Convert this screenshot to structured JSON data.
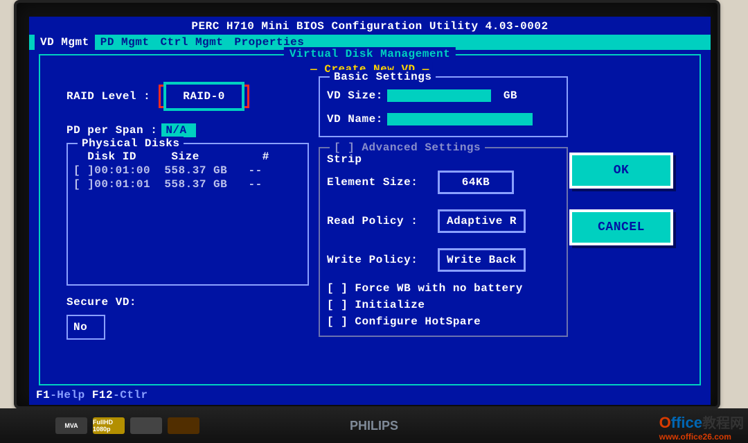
{
  "title": "PERC H710 Mini BIOS Configuration Utility 4.03-0002",
  "menu": {
    "items": [
      "VD Mgmt",
      "PD Mgmt",
      "Ctrl Mgmt",
      "Properties"
    ],
    "active_index": 0
  },
  "outer_frame_title": "Virtual Disk Management",
  "create_title": "— Create New VD —",
  "left": {
    "raid_label": "RAID Level :",
    "raid_value": "RAID-0",
    "pd_span_label": "PD per Span :",
    "pd_span_value": "N/A",
    "phys_group": "Physical Disks",
    "phys_header": "  Disk ID     Size         #",
    "phys_rows": [
      "[ ]00:01:00  558.37 GB   --",
      "[ ]00:01:01  558.37 GB   --"
    ],
    "secure_label": "Secure VD:",
    "secure_value": "No"
  },
  "basic": {
    "group": "Basic Settings",
    "size_label": "VD Size:",
    "size_value": "",
    "size_unit": "GB",
    "name_label": "VD Name:",
    "name_value": ""
  },
  "advanced": {
    "group_prefix": "[ ] Advanced Settings",
    "strip_label1": "Strip",
    "strip_label2": "Element Size:",
    "strip_value": "64KB",
    "read_label": "Read Policy :",
    "read_value": "Adaptive R",
    "write_label": "Write Policy:",
    "write_value": "Write Back",
    "checks": [
      "[ ] Force WB with no battery",
      "[ ] Initialize",
      "[ ] Configure HotSpare"
    ]
  },
  "buttons": {
    "ok": "OK",
    "cancel": "CANCEL"
  },
  "status": {
    "f1": "F1",
    "f1txt": "-Help ",
    "f12": "F12",
    "f12txt": "-Ctlr"
  },
  "monitor_brand": "PHILIPS",
  "bezel_logos": [
    "MVA",
    "FullHD 1080p",
    "",
    ""
  ],
  "watermark": {
    "line1a": "Office",
    "line1b": "教程网",
    "line2": "www.office26.com"
  }
}
